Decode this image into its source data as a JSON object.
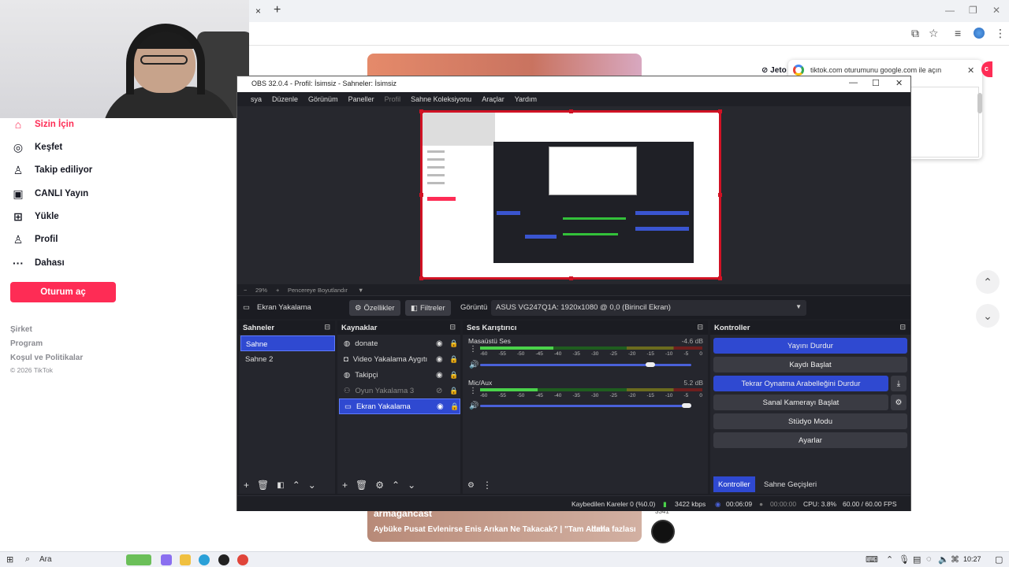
{
  "browser": {
    "tab_close": "×",
    "tab_new": "+",
    "win_min": "—",
    "win_max": "❐",
    "win_close": "✕",
    "toolbar_icons": [
      "screen-share-icon",
      "bookmark-star-icon",
      "tab-search-icon",
      "profile-icon",
      "kebab-menu-icon"
    ]
  },
  "tiktok": {
    "nav": [
      {
        "label": "Sizin İçin",
        "icon": "home-icon",
        "glyph": "⌂",
        "active": true
      },
      {
        "label": "Keşfet",
        "icon": "compass-icon",
        "glyph": "◎"
      },
      {
        "label": "Takip ediliyor",
        "icon": "following-icon",
        "glyph": "♙"
      },
      {
        "label": "CANLI Yayın",
        "icon": "live-icon",
        "glyph": "▣"
      },
      {
        "label": "Yükle",
        "icon": "upload-icon",
        "glyph": "⊞"
      },
      {
        "label": "Profil",
        "icon": "profile-icon",
        "glyph": "♙"
      },
      {
        "label": "Dahası",
        "icon": "more-icon",
        "glyph": "···"
      }
    ],
    "login_button": "Oturum aç",
    "footer": [
      "Şirket",
      "Program",
      "Koşul ve Politikalar"
    ],
    "copyright": "© 2026 TikTok",
    "jeton": "Jeto",
    "video_author": "armagancast",
    "video_title": "Aybüke Pusat Evlenirse Enis Arıkan Ne Takacak? | \"Tam Altınla",
    "video_more": "daha fazlası",
    "avatar_count": "3341",
    "google_popup_text": "tiktok.com oturumunu google.com ile açın",
    "badge": "c"
  },
  "obs": {
    "title": "OBS 32.0.4 - Profil: İsimsiz - Sahneler: İsimsiz",
    "menu": [
      "sya",
      "Düzenle",
      "Görünüm",
      "Paneller",
      "Profil",
      "Sahne Koleksiyonu",
      "Araçlar",
      "Yardım"
    ],
    "zoom": {
      "minus": "−",
      "value": "29%",
      "plus": "+",
      "fit_label": "Pencereye Boyutlandır"
    },
    "source_toolbar": {
      "selected_source": "Ekran Yakalama",
      "properties": "Özellikler",
      "filters": "Filtreler",
      "display_label": "Görüntü",
      "display_value": "ASUS VG247Q1A: 1920x1080 @ 0,0 (Birincil Ekran)"
    },
    "scenes": {
      "title": "Sahneler",
      "items": [
        "Sahne",
        "Sahne 2"
      ]
    },
    "sources": {
      "title": "Kaynaklar",
      "items": [
        "donate",
        "Video Yakalama Aygıtı",
        "Takipçi",
        "Oyun Yakalama 3",
        "Ekran Yakalama"
      ]
    },
    "mixer": {
      "title": "Ses Karıştırıcı",
      "channels": [
        {
          "name": "Masaüstü Ses",
          "db": "-4.6 dB",
          "level": 0.33,
          "volume": 0.82
        },
        {
          "name": "Mic/Aux",
          "db": "5.2 dB",
          "level": 0.26,
          "volume": 1.0
        }
      ],
      "scale": [
        "-60",
        "-55",
        "-50",
        "-45",
        "-40",
        "-35",
        "-30",
        "-25",
        "-20",
        "-15",
        "-10",
        "-5",
        "0"
      ]
    },
    "controls": {
      "title": "Kontroller",
      "buttons": [
        "Yayını Durdur",
        "Kaydı Başlat",
        "Tekrar Oynatma Arabelleğini Durdur",
        "Sanal Kamerayı Başlat",
        "Stüdyo Modu",
        "Ayarlar"
      ],
      "tabs": [
        "Kontroller",
        "Sahne Geçişleri"
      ]
    },
    "status": {
      "dropped": "Kaybedilen Kareler 0 (%0.0)",
      "bitrate": "3422 kbps",
      "stream_time": "00:06:09",
      "rec_time": "00:00:00",
      "cpu": "CPU: 3.8%",
      "fps": "60.00 / 60.00 FPS"
    }
  },
  "taskbar": {
    "search": "Ara",
    "clock": "10:27"
  },
  "colors": {
    "tiktok_red": "#fe2c55",
    "obs_blue": "#2f49d1",
    "obs_bg": "#25262d"
  }
}
